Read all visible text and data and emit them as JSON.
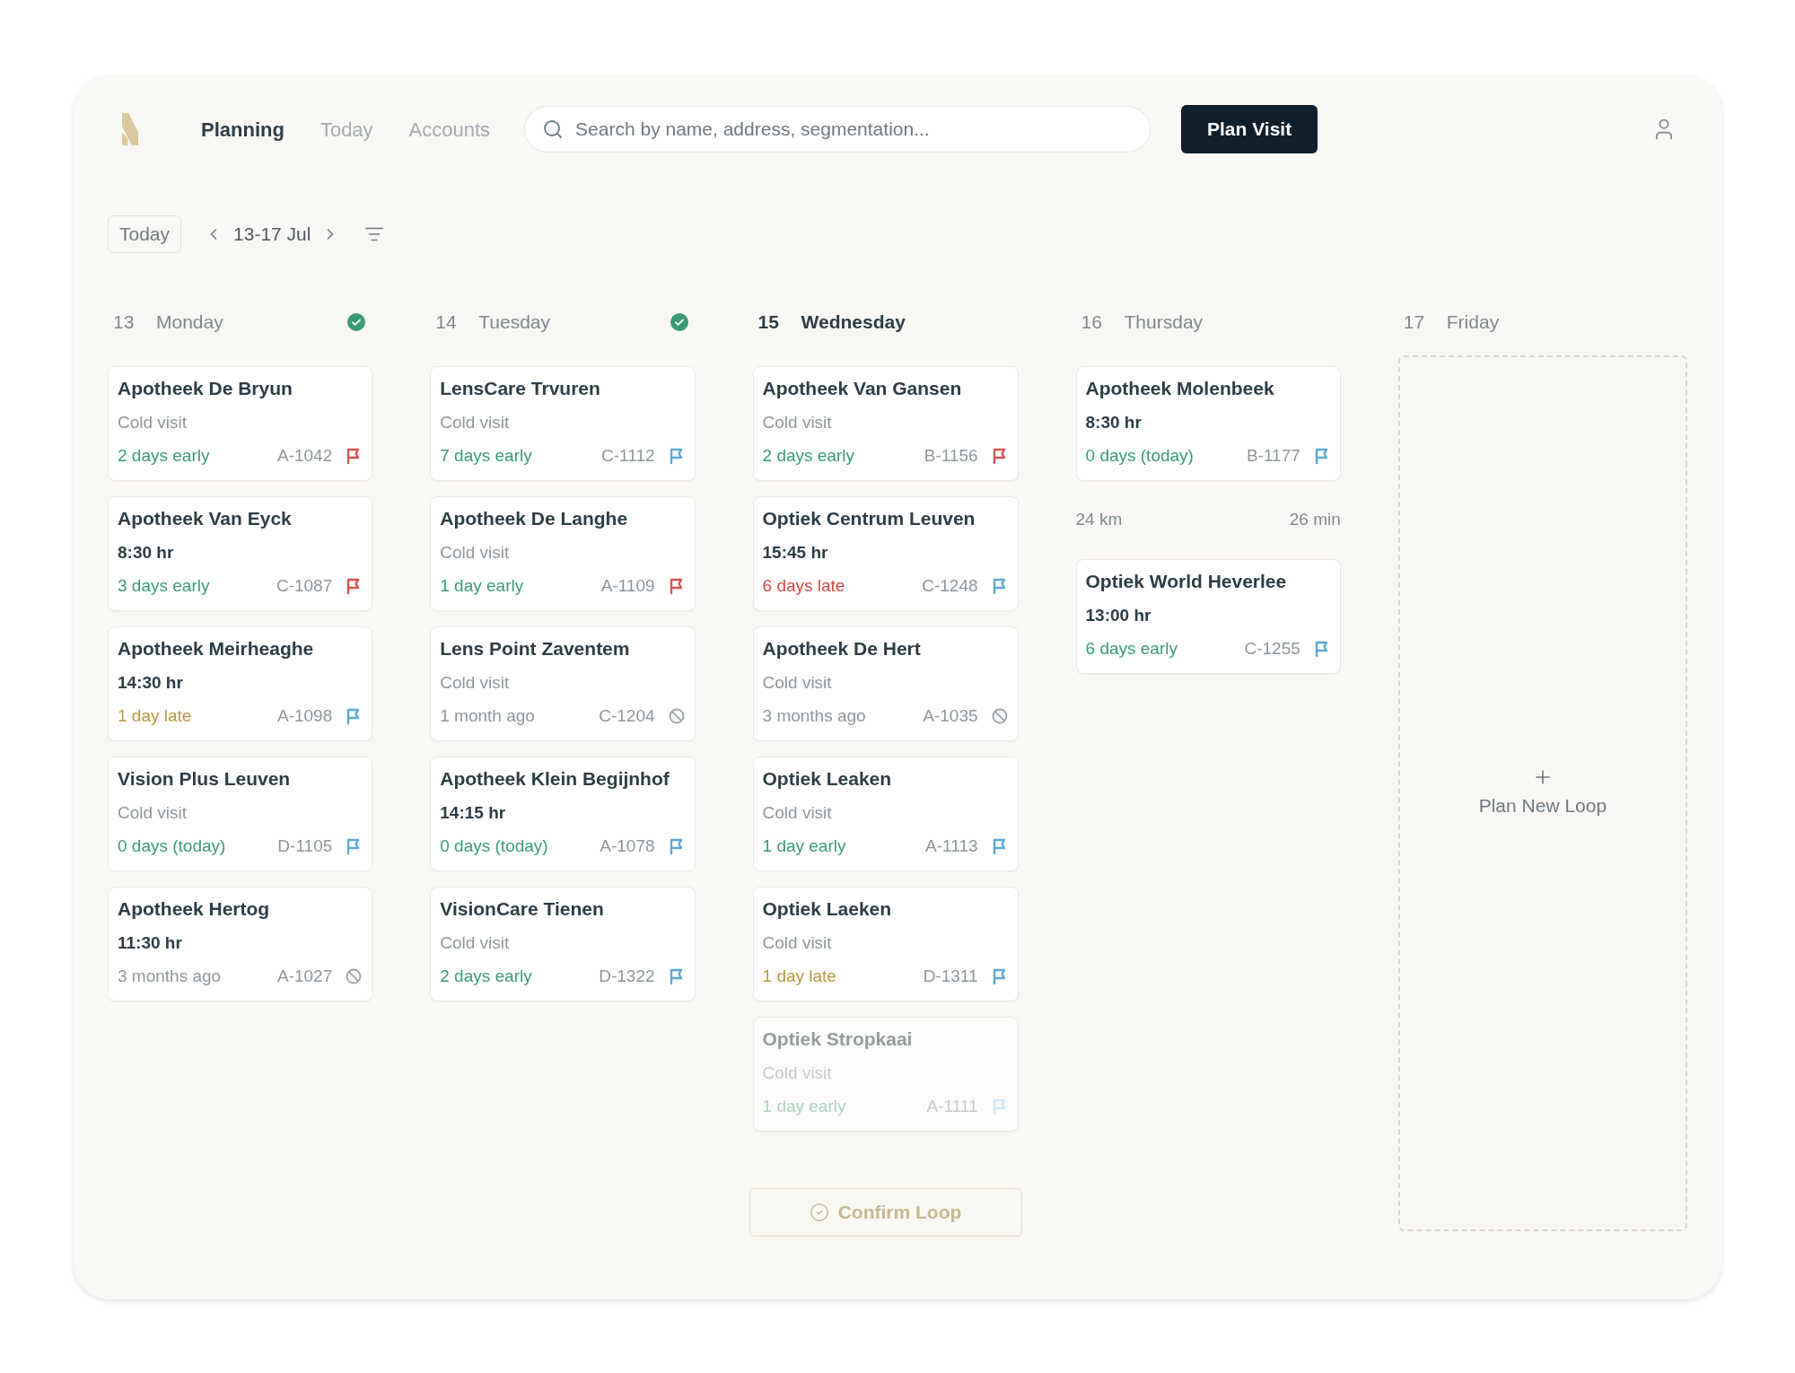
{
  "nav": [
    {
      "label": "Planning",
      "selected": true
    },
    {
      "label": "Today",
      "selected": false
    },
    {
      "label": "Accounts",
      "selected": false
    }
  ],
  "search": {
    "placeholder": "Search by name, address, segmentation..."
  },
  "plan_button": "Plan Visit",
  "toolbar": {
    "today_button": "Today",
    "range": "13-17 Jul"
  },
  "days": [
    {
      "number": "13",
      "name": "Monday",
      "selected": false,
      "done": true,
      "cards": [
        {
          "title": "Apotheek De Bryun",
          "visit_type": "Cold visit",
          "status": {
            "text": "2 days early",
            "color": "#3a9a74"
          },
          "code": "A-1042",
          "flag": {
            "color": "#d9534f"
          },
          "faded": false
        },
        {
          "title": "Apotheek Van Eyck",
          "time": "8:30 hr",
          "status": {
            "text": "3 days early",
            "color": "#3a9a74"
          },
          "code": "C-1087",
          "flag": {
            "color": "#d9534f"
          },
          "faded": false
        },
        {
          "title": "Apotheek Meirheaghe",
          "time": "14:30 hr",
          "status": {
            "text": "1 day late",
            "color": "#b8983f"
          },
          "code": "A-1098",
          "flag": {
            "color": "#5aa9d6"
          },
          "faded": false
        },
        {
          "title": "Vision Plus Leuven",
          "visit_type": "Cold visit",
          "status": {
            "text": "0 days (today)",
            "color": "#3a9a74"
          },
          "code": "D-1105",
          "flag": {
            "color": "#5aa9d6"
          },
          "faded": false
        },
        {
          "title": "Apotheek Hertog",
          "time": "11:30 hr",
          "status": {
            "text": "3 months ago",
            "color": "#8d969b"
          },
          "code": "A-1027",
          "faded": false
        }
      ]
    },
    {
      "number": "14",
      "name": "Tuesday",
      "selected": false,
      "done": true,
      "cards": [
        {
          "title": "LensCare Trvuren",
          "visit_type": "Cold visit",
          "status": {
            "text": "7 days early",
            "color": "#3a9a74"
          },
          "code": "C-1112",
          "flag": {
            "color": "#5aa9d6"
          },
          "faded": false
        },
        {
          "title": "Apotheek De Langhe",
          "visit_type": "Cold visit",
          "status": {
            "text": "1 day early",
            "color": "#3a9a74"
          },
          "code": "A-1109",
          "flag": {
            "color": "#d9534f"
          },
          "faded": false
        },
        {
          "title": "Lens Point Zaventem",
          "visit_type": "Cold visit",
          "status": {
            "text": "1 month ago",
            "color": "#8d969b"
          },
          "code": "C-1204",
          "faded": false
        },
        {
          "title": "Apotheek Klein Begijnhof",
          "time": "14:15 hr",
          "status": {
            "text": "0 days (today)",
            "color": "#3a9a74"
          },
          "code": "A-1078",
          "flag": {
            "color": "#5aa9d6"
          },
          "faded": false
        },
        {
          "title": "VisionCare Tienen",
          "visit_type": "Cold visit",
          "status": {
            "text": "2 days early",
            "color": "#3a9a74"
          },
          "code": "D-1322",
          "flag": {
            "color": "#5aa9d6"
          },
          "faded": false
        }
      ]
    },
    {
      "number": "15",
      "name": "Wednesday",
      "selected": true,
      "done": false,
      "cards": [
        {
          "title": "Apotheek Van Gansen",
          "visit_type": "Cold visit",
          "status": {
            "text": "2 days early",
            "color": "#3a9a74"
          },
          "code": "B-1156",
          "flag": {
            "color": "#d9534f"
          },
          "faded": false
        },
        {
          "title": "Optiek Centrum Leuven",
          "time": "15:45 hr",
          "status": {
            "text": "6 days late",
            "color": "#cf4a45"
          },
          "code": "C-1248",
          "flag": {
            "color": "#5aa9d6"
          },
          "faded": false
        },
        {
          "title": "Apotheek De Hert",
          "visit_type": "Cold visit",
          "status": {
            "text": "3 months ago",
            "color": "#8d969b"
          },
          "code": "A-1035",
          "faded": false
        },
        {
          "title": "Optiek Leaken",
          "visit_type": "Cold visit",
          "status": {
            "text": "1 day early",
            "color": "#3a9a74"
          },
          "code": "A-1113",
          "flag": {
            "color": "#5aa9d6"
          },
          "faded": false
        },
        {
          "title": "Optiek Laeken",
          "visit_type": "Cold visit",
          "status": {
            "text": "1 day late",
            "color": "#b8983f"
          },
          "code": "D-1311",
          "flag": {
            "color": "#5aa9d6"
          },
          "faded": false
        },
        {
          "title": "Optiek Stropkaai",
          "visit_type": "Cold visit",
          "status": {
            "text": "1 day early",
            "color": "#a9d3c2"
          },
          "code": "A-1111",
          "flag": {
            "color": "#d3e7f3"
          },
          "faded": true
        }
      ],
      "confirm": {
        "label": "Confirm Loop",
        "disabled": true
      }
    },
    {
      "number": "16",
      "name": "Thursday",
      "selected": false,
      "done": false,
      "cards": [
        {
          "title": "Apotheek Molenbeek",
          "time": "8:30 hr",
          "status": {
            "text": "0 days (today)",
            "color": "#3a9a74"
          },
          "code": "B-1177",
          "flag": {
            "color": "#5aa9d6"
          },
          "faded": false
        },
        {
          "title": "Optiek World Heverlee",
          "time": "13:00 hr",
          "status": {
            "text": "6 days early",
            "color": "#3a9a74"
          },
          "code": "C-1255",
          "flag": {
            "color": "#5aa9d6"
          },
          "faded": false
        }
      ],
      "route": {
        "distance": "24 km",
        "duration": "26 min"
      }
    },
    {
      "number": "17",
      "name": "Friday",
      "selected": false,
      "done": false,
      "empty_label": "Plan New Loop"
    }
  ]
}
